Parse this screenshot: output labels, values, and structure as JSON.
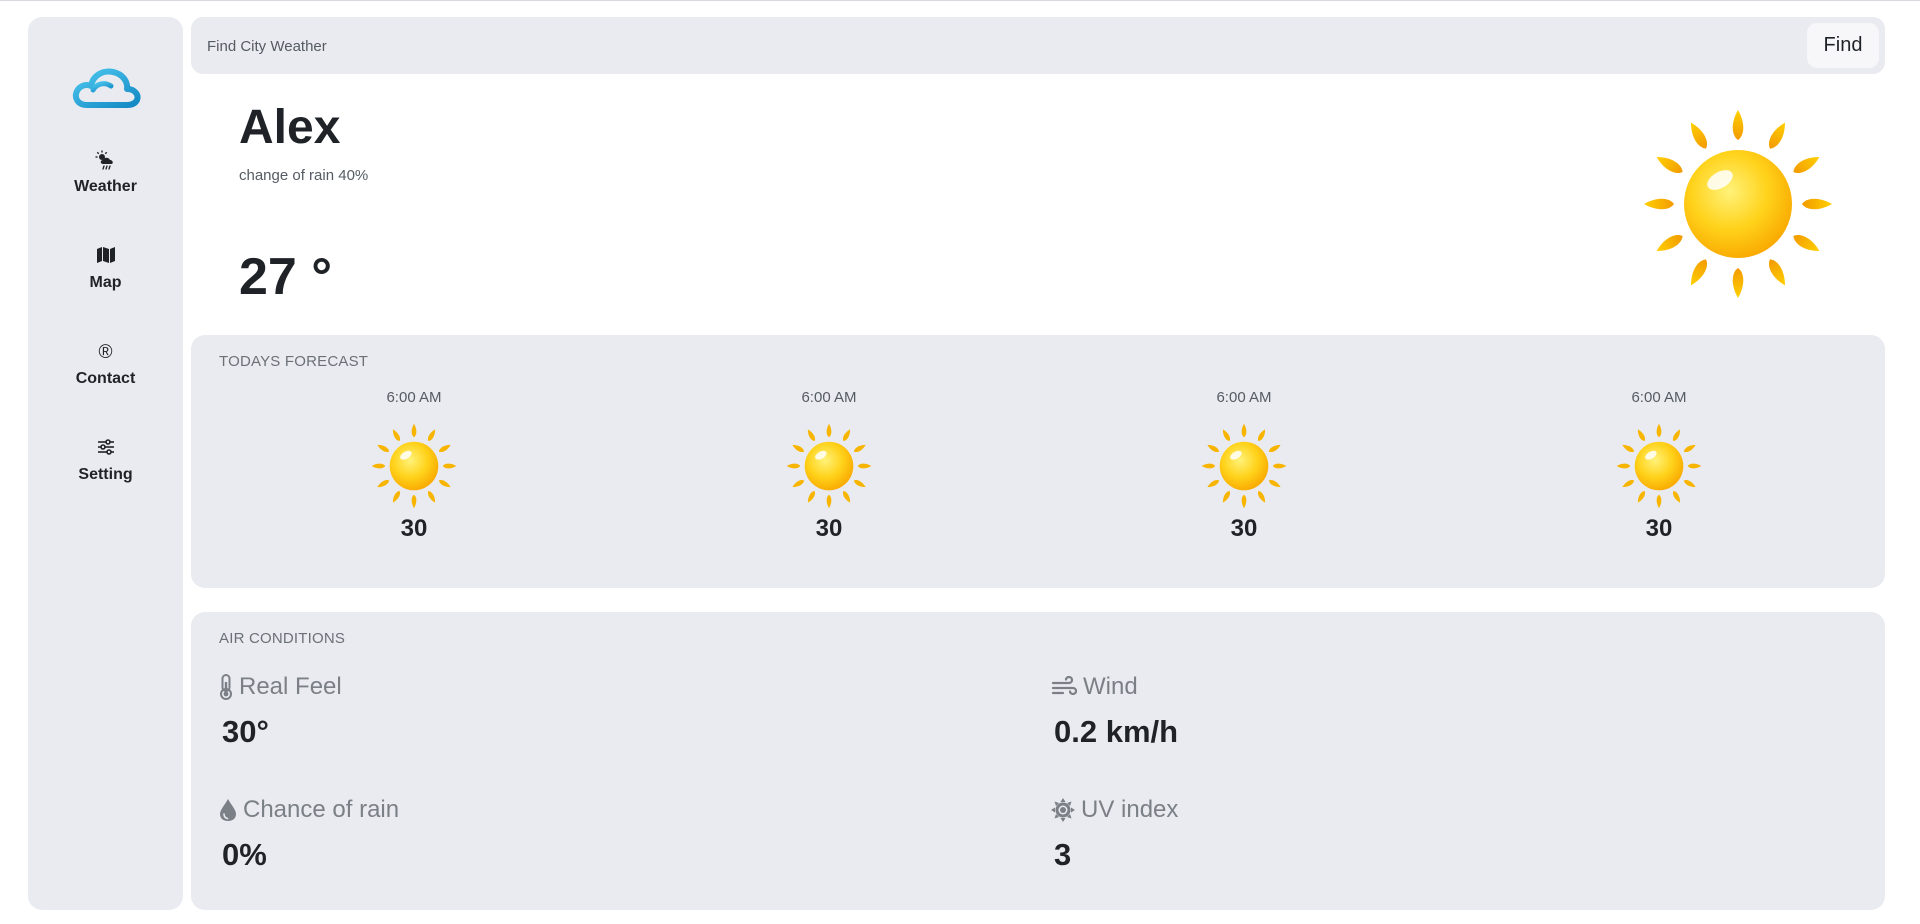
{
  "sidebar": {
    "items": [
      {
        "label": "Weather",
        "icon": "cloud-sun-rain-icon"
      },
      {
        "label": "Map",
        "icon": "map-icon"
      },
      {
        "label": "Contact",
        "icon": "registered-icon"
      },
      {
        "label": "Setting",
        "icon": "sliders-icon"
      }
    ],
    "logo_icon": "cloud-logo-icon",
    "contact_glyph": "®"
  },
  "search": {
    "placeholder": "Find City Weather",
    "button_label": "Find"
  },
  "hero": {
    "city": "Alex",
    "rain_text": "change of rain 40%",
    "temperature": "27 °",
    "icon": "sun-icon"
  },
  "forecast": {
    "title": "TODAYS FORECAST",
    "slots": [
      {
        "time": "6:00 AM",
        "temp": "30",
        "icon": "sun-icon"
      },
      {
        "time": "6:00 AM",
        "temp": "30",
        "icon": "sun-icon"
      },
      {
        "time": "6:00 AM",
        "temp": "30",
        "icon": "sun-icon"
      },
      {
        "time": "6:00 AM",
        "temp": "30",
        "icon": "sun-icon"
      }
    ]
  },
  "air": {
    "title": "AIR CONDITIONS",
    "real_feel": {
      "label": "Real Feel",
      "value": "30°",
      "icon": "thermometer-icon"
    },
    "wind": {
      "label": "Wind",
      "value": "0.2 km/h",
      "icon": "wind-icon"
    },
    "rain": {
      "label": "Chance of rain",
      "value": "0%",
      "icon": "droplet-icon"
    },
    "uv": {
      "label": "UV index",
      "value": "3",
      "icon": "sun-gear-icon"
    }
  },
  "colors": {
    "panel_bg": "#eaebf0",
    "logo_blue": "#1fa3dc",
    "sun_yellow": "#ffcc00"
  }
}
